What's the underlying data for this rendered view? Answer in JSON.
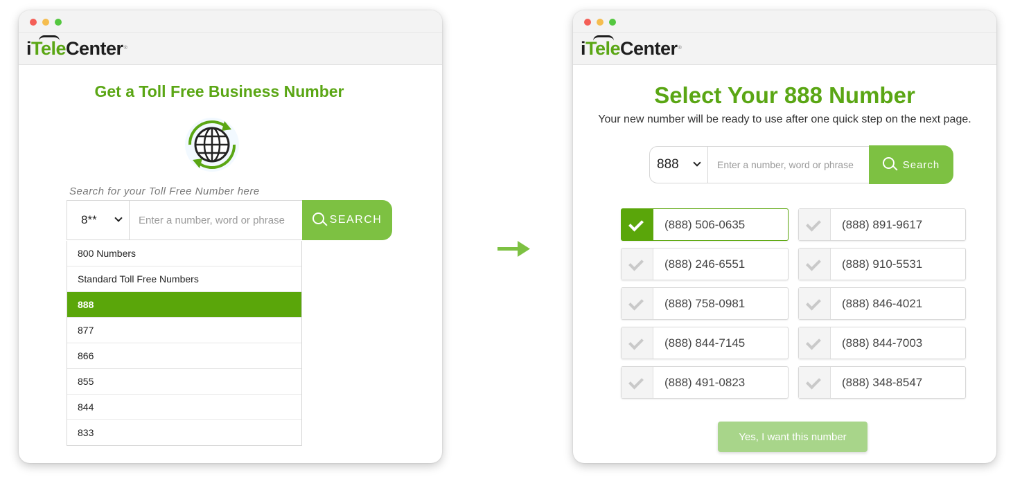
{
  "colors": {
    "brand_green": "#5aa614",
    "button_green": "#7dc142",
    "selected_green": "#5aa60a",
    "confirm_disabled": "#a8d58a"
  },
  "logo": {
    "i": "i",
    "tele": "Tele",
    "center": "Center",
    "reg": "®"
  },
  "left": {
    "title": "Get a Toll Free Business Number",
    "icon": "globe-refresh-icon",
    "search_hint": "Search for your Toll Free Number here",
    "select_value": "8**",
    "input_placeholder": "Enter a number, word or phrase",
    "search_label": "SEARCH",
    "dropdown": [
      {
        "label": "800 Numbers",
        "selected": false
      },
      {
        "label": "Standard Toll Free Numbers",
        "selected": false
      },
      {
        "label": "888",
        "selected": true
      },
      {
        "label": "877",
        "selected": false
      },
      {
        "label": "866",
        "selected": false
      },
      {
        "label": "855",
        "selected": false
      },
      {
        "label": "844",
        "selected": false
      },
      {
        "label": "833",
        "selected": false
      }
    ]
  },
  "arrow_icon": "right-arrow-icon",
  "right": {
    "title": "Select Your 888 Number",
    "subtitle": "Your new number will be ready to use after one quick step on the next page.",
    "select_value": "888",
    "input_placeholder": "Enter a number, word or phrase",
    "search_label": "Search",
    "numbers": [
      {
        "number": "(888) 506-0635",
        "selected": true
      },
      {
        "number": "(888) 891-9617",
        "selected": false
      },
      {
        "number": "(888) 246-6551",
        "selected": false
      },
      {
        "number": "(888) 910-5531",
        "selected": false
      },
      {
        "number": "(888) 758-0981",
        "selected": false
      },
      {
        "number": "(888) 846-4021",
        "selected": false
      },
      {
        "number": "(888) 844-7145",
        "selected": false
      },
      {
        "number": "(888) 844-7003",
        "selected": false
      },
      {
        "number": "(888) 491-0823",
        "selected": false
      },
      {
        "number": "(888) 348-8547",
        "selected": false
      }
    ],
    "confirm_label": "Yes, I want this number"
  }
}
